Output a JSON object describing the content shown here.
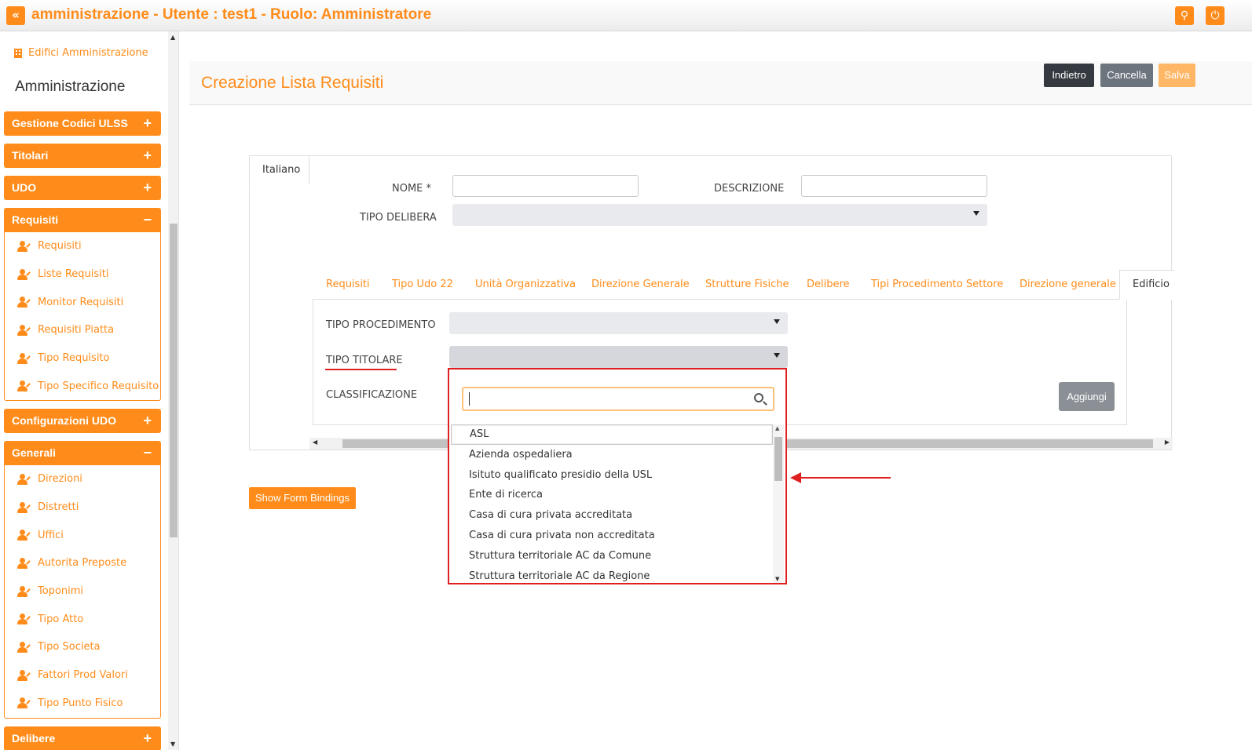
{
  "header": {
    "back_icon": "double-chevron-left-icon",
    "title": "amministrazione - Utente : test1 - Ruolo: Amministratore",
    "globe_icon": "globe-icon",
    "power_icon": "power-icon"
  },
  "sidebar": {
    "top_link": "Edifici Amministrazione",
    "heading": "Amministrazione",
    "sections": [
      {
        "label": "Gestione Codici ULSS",
        "toggle": "+"
      },
      {
        "label": "Titolari",
        "toggle": "+"
      },
      {
        "label": "UDO",
        "toggle": "+"
      },
      {
        "label": "Requisiti",
        "toggle": "−"
      },
      {
        "label": "Configurazioni UDO",
        "toggle": "+"
      },
      {
        "label": "Generali",
        "toggle": "−"
      },
      {
        "label": "Delibere",
        "toggle": "+"
      }
    ],
    "requisiti_items": [
      "Requisiti",
      "Liste Requisiti",
      "Monitor Requisiti",
      "Requisiti Piatta",
      "Tipo Requisito",
      "Tipo Specifico Requisito"
    ],
    "generali_items": [
      "Direzioni",
      "Distretti",
      "Uffici",
      "Autorita Preposte",
      "Toponimi",
      "Tipo Atto",
      "Tipo Societa",
      "Fattori Prod Valori",
      "Tipo Punto Fisico"
    ]
  },
  "page": {
    "title": "Creazione Lista Requisiti",
    "buttons": {
      "back": "Indietro",
      "cancel": "Cancella",
      "save": "Salva"
    }
  },
  "form": {
    "lang_tab": "Italiano",
    "nome_label": "NOME *",
    "descrizione_label": "DESCRIZIONE",
    "tipo_delibera_label": "TIPO DELIBERA",
    "tabs": [
      "Requisiti",
      "Tipo Udo 22",
      "Unità Organizzativa",
      "Direzione Generale",
      "Strutture Fisiche",
      "Delibere",
      "Tipi Procedimento Settore",
      "Direzione generale",
      "Edificio"
    ],
    "tipo_procedimento_label": "TIPO PROCEDIMENTO",
    "tipo_titolare_label": "TIPO TITOLARE",
    "classificazione_label": "CLASSIFICAZIONE",
    "add_button": "Aggiungi",
    "form_bindings_button": "Show Form Bindings"
  },
  "dropdown": {
    "search_value": "",
    "options": [
      "ASL",
      "Azienda ospedaliera",
      "Isituto qualificato presidio della USL",
      "Ente di ricerca",
      "Casa di cura privata accreditata",
      "Casa di cura privata non accreditata",
      "Struttura territoriale AC da Comune",
      "Struttura territoriale AC da Regione"
    ],
    "highlighted": "ASL"
  },
  "colors": {
    "accent": "#ff8c1a",
    "annotation": "#e02020",
    "dark_button": "#343a40",
    "grey_button": "#6c757d"
  }
}
